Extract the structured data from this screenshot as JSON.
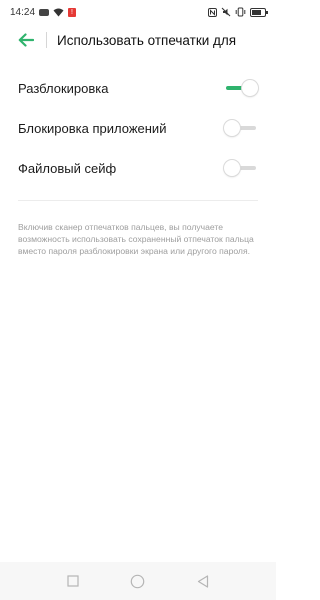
{
  "status_bar": {
    "time": "14:24",
    "left_icons": [
      "youtube-icon",
      "wifi-icon",
      "alert-icon"
    ],
    "right_icons": [
      "nfc-icon",
      "mute-icon",
      "vibrate-icon",
      "battery-icon"
    ]
  },
  "header": {
    "back_icon": "arrow-left-icon",
    "title": "Использовать отпечатки для"
  },
  "settings": [
    {
      "label": "Разблокировка",
      "enabled": true
    },
    {
      "label": "Блокировка приложений",
      "enabled": false
    },
    {
      "label": "Файловый сейф",
      "enabled": false
    }
  ],
  "hint_text": "Включив сканер отпечатков пальцев, вы получаете возможность использовать сохраненный отпечаток пальца вместо пароля разблокировки экрана или другого пароля.",
  "colors": {
    "accent": "#2fb36d",
    "switch_off_track": "#d9d9d9",
    "hint": "#9e9e9e"
  },
  "nav_bar": {
    "buttons": [
      "recent-apps-icon",
      "home-icon",
      "back-triangle-icon"
    ]
  }
}
